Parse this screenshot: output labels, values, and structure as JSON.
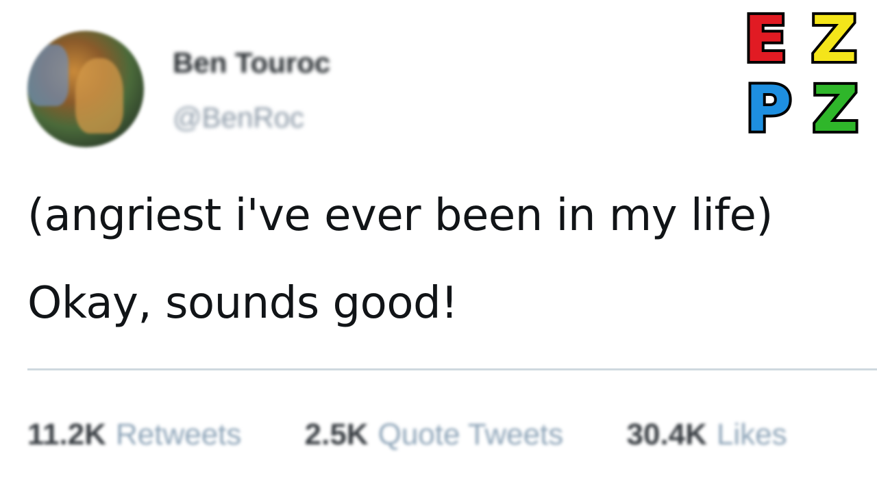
{
  "tweet": {
    "display_name": "Ben Touroc",
    "handle": "@BenRoc",
    "lines": [
      "(angriest i've ever been in my life)",
      "Okay, sounds good!"
    ],
    "stats": [
      {
        "count": "11.2K",
        "label": "Retweets"
      },
      {
        "count": "2.5K",
        "label": "Quote Tweets"
      },
      {
        "count": "30.4K",
        "label": "Likes"
      }
    ]
  },
  "logo": {
    "letters": [
      "E",
      "Z",
      "P",
      "Z"
    ],
    "colors": [
      "#e11b23",
      "#f4e51a",
      "#1e8fe0",
      "#2fb62a"
    ]
  },
  "colors": {
    "divider": "#cfd9df",
    "stat_label": "#8da4b8"
  }
}
